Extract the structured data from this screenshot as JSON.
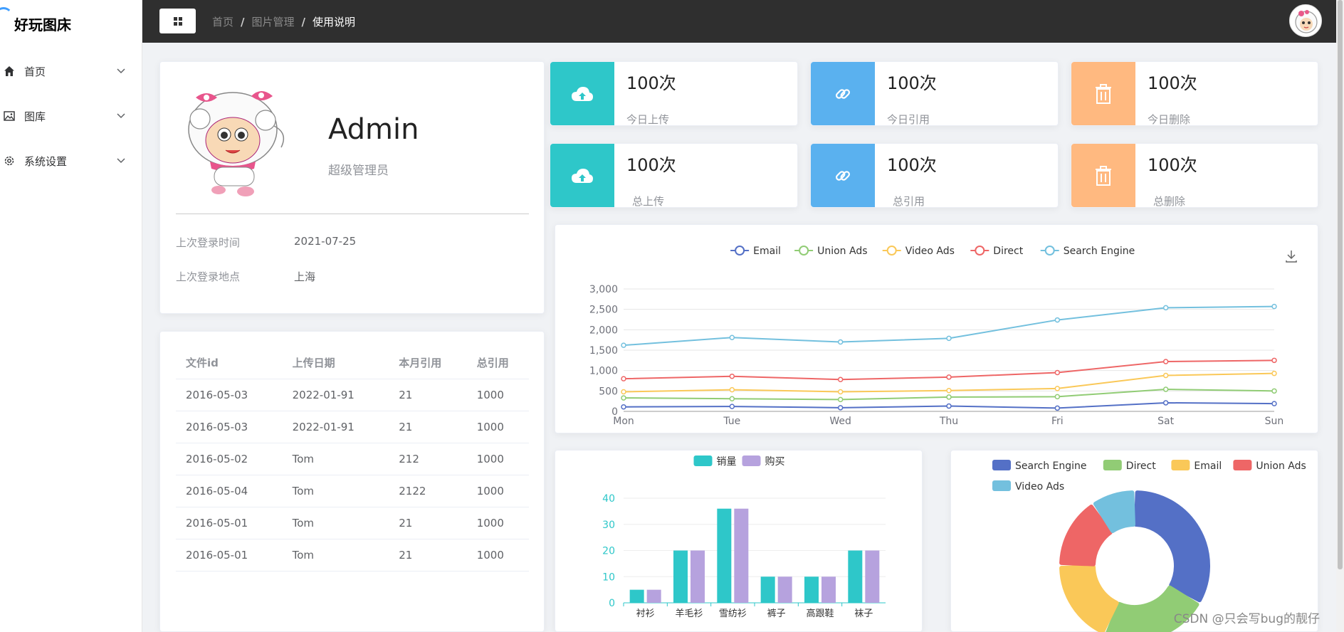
{
  "app": {
    "title": "好玩图床"
  },
  "sidebar": {
    "items": [
      {
        "label": "首页",
        "icon": "home-icon"
      },
      {
        "label": "图库",
        "icon": "image-icon"
      },
      {
        "label": "系统设置",
        "icon": "gear-icon"
      }
    ]
  },
  "header": {
    "breadcrumb": [
      "首页",
      "图片管理",
      "使用说明"
    ]
  },
  "profile": {
    "name": "Admin",
    "role": "超级管理员",
    "last_login_time_label": "上次登录时间",
    "last_login_time": "2021-07-25",
    "last_login_place_label": "上次登录地点",
    "last_login_place": "上海"
  },
  "stats": [
    {
      "value": "100次",
      "label": "今日上传",
      "icon": "cloud-upload-icon",
      "color": "#2ec7c9"
    },
    {
      "value": "100次",
      "label": "今日引用",
      "icon": "link-icon",
      "color": "#5ab1ef"
    },
    {
      "value": "100次",
      "label": "今日删除",
      "icon": "trash-icon",
      "color": "#ffb980"
    },
    {
      "value": "100次",
      "label": "总上传",
      "icon": "cloud-upload-icon",
      "color": "#2ec7c9"
    },
    {
      "value": "100次",
      "label": "总引用",
      "icon": "link-icon",
      "color": "#5ab1ef"
    },
    {
      "value": "100次",
      "label": "总删除",
      "icon": "trash-icon",
      "color": "#ffb980"
    }
  ],
  "table": {
    "headers": [
      "文件id",
      "上传日期",
      "本月引用",
      "总引用"
    ],
    "rows": [
      [
        "2016-05-03",
        "2022-01-91",
        "21",
        "1000"
      ],
      [
        "2016-05-03",
        "2022-01-91",
        "21",
        "1000"
      ],
      [
        "2016-05-02",
        "Tom",
        "212",
        "1000"
      ],
      [
        "2016-05-04",
        "Tom",
        "2122",
        "1000"
      ],
      [
        "2016-05-01",
        "Tom",
        "21",
        "1000"
      ],
      [
        "2016-05-01",
        "Tom",
        "21",
        "1000"
      ]
    ]
  },
  "watermark": "CSDN @只会写bug的靓仔",
  "chart_data": [
    {
      "type": "line",
      "x": [
        "Mon",
        "Tue",
        "Wed",
        "Thu",
        "Fri",
        "Sat",
        "Sun"
      ],
      "ylim": [
        0,
        3000
      ],
      "yticks": [
        "0",
        "500",
        "1,000",
        "1,500",
        "2,000",
        "2,500",
        "3,000"
      ],
      "grid": true,
      "legend": "top-center",
      "series": [
        {
          "name": "Email",
          "color": "#5470c6",
          "values": [
            110,
            120,
            90,
            130,
            80,
            210,
            190
          ]
        },
        {
          "name": "Union Ads",
          "color": "#91cc75",
          "values": [
            330,
            310,
            290,
            350,
            360,
            540,
            500
          ]
        },
        {
          "name": "Video Ads",
          "color": "#fac858",
          "values": [
            480,
            530,
            480,
            510,
            560,
            880,
            930
          ]
        },
        {
          "name": "Direct",
          "color": "#ee6666",
          "values": [
            800,
            860,
            780,
            840,
            950,
            1220,
            1250
          ]
        },
        {
          "name": "Search Engine",
          "color": "#73c0de",
          "values": [
            1620,
            1810,
            1700,
            1790,
            2240,
            2540,
            2570
          ]
        }
      ]
    },
    {
      "type": "bar",
      "categories": [
        "衬衫",
        "羊毛衫",
        "雪纺衫",
        "裤子",
        "高跟鞋",
        "袜子"
      ],
      "ylim": [
        0,
        40
      ],
      "yticks": [
        "0",
        "10",
        "20",
        "30",
        "40"
      ],
      "legend": "top-center",
      "series": [
        {
          "name": "销量",
          "color": "#2ec7c9",
          "values": [
            5,
            20,
            36,
            10,
            10,
            20
          ]
        },
        {
          "name": "购买",
          "color": "#b6a2de",
          "values": [
            5,
            20,
            36,
            10,
            10,
            20
          ]
        }
      ]
    },
    {
      "type": "pie",
      "legend": "top-center",
      "series": [
        {
          "name": "Search Engine",
          "color": "#5470c6",
          "value": 1048
        },
        {
          "name": "Direct",
          "color": "#91cc75",
          "value": 735
        },
        {
          "name": "Email",
          "color": "#fac858",
          "value": 580
        },
        {
          "name": "Union Ads",
          "color": "#ee6666",
          "value": 484
        },
        {
          "name": "Video Ads",
          "color": "#73c0de",
          "value": 300
        }
      ]
    }
  ]
}
